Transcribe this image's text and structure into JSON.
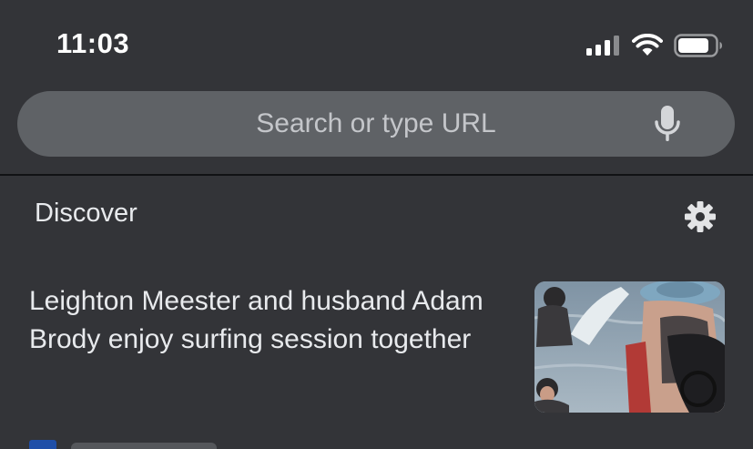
{
  "status_bar": {
    "time": "11:03",
    "icons": [
      "cellular-signal-icon",
      "wifi-icon",
      "battery-icon"
    ]
  },
  "omnibox": {
    "placeholder": "Search or type URL",
    "voice_icon": "mic-icon"
  },
  "discover": {
    "title": "Discover",
    "settings_icon": "gear-icon"
  },
  "feed": {
    "articles": [
      {
        "headline": "Leighton Meester and husband Adam Brody enjoy surfing session together",
        "thumbnail": "surfing-photo"
      }
    ]
  },
  "colors": {
    "background": "#333438",
    "omnibox": "#5f6266",
    "text": "#e8eaed",
    "favicon": "#1f4fa8"
  }
}
